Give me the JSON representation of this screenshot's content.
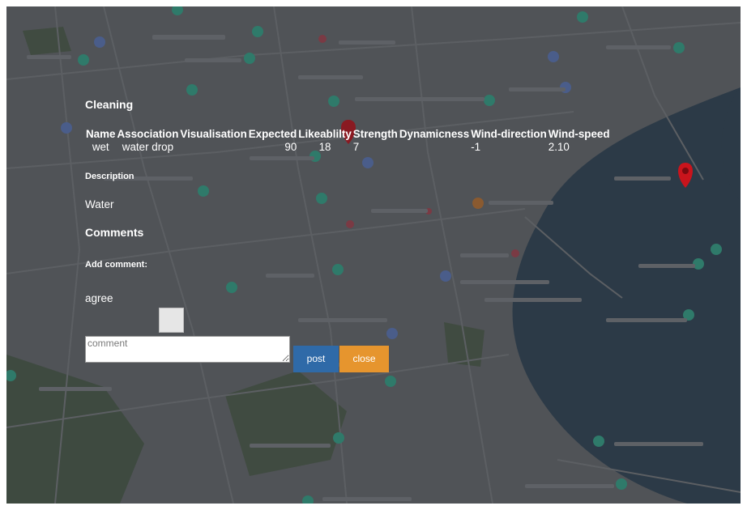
{
  "panel": {
    "title": "Cleaning",
    "table": {
      "headers": [
        "Name",
        "Association",
        "Visualisation",
        "Expected",
        "Likeablilty",
        "Strength",
        "Dynamicness",
        "Wind-direction",
        "Wind-speed"
      ],
      "row": [
        "wet",
        "water drop",
        "90",
        "18",
        "7",
        "-1",
        "2.10"
      ]
    },
    "description_label": "Description",
    "description_value": "Water",
    "comments_heading": "Comments",
    "add_comment_label": "Add comment:",
    "comments": [
      "agree"
    ],
    "comment_input": {
      "placeholder": "comment",
      "value": ""
    },
    "post_label": "post",
    "close_label": "close"
  },
  "colors": {
    "overlay_tint": "#4a4d51",
    "river": "#2b3a48",
    "post_button": "#2f6aa8",
    "close_button": "#e6952e",
    "marker": "#d92027"
  },
  "icons": [
    "map-pin-icon",
    "place-marker-icon"
  ]
}
